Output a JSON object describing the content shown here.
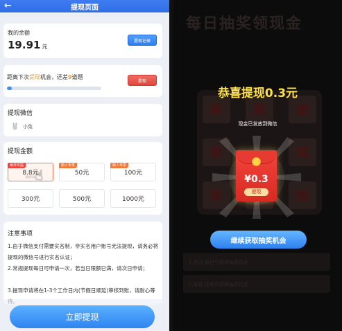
{
  "left": {
    "header": {
      "title": "提现页面",
      "back_icon": "back-arrow-icon"
    },
    "balance": {
      "label": "我的余额",
      "amount": "19.91",
      "unit": "元",
      "records_button": "提现记录"
    },
    "progress": {
      "prefix": "距离下次",
      "highlight": "提现",
      "middle": "机会，还差",
      "count": "9",
      "suffix": "道题",
      "withdraw_button": "提现",
      "percent": 5
    },
    "wechat": {
      "title": "提现微信",
      "user_name": "小兔",
      "avatar_icon": "bunny-avatar-icon"
    },
    "amounts": {
      "title": "提现金额",
      "options": [
        {
          "tag": "每日可提",
          "value": "8.8",
          "unit": "元",
          "sub": "提现1次",
          "selected": true
        },
        {
          "tag": "新人专享",
          "value": "50元"
        },
        {
          "tag": "新人专享",
          "value": "100元"
        },
        {
          "value": "300元"
        },
        {
          "value": "500元"
        },
        {
          "value": "1000元"
        }
      ]
    },
    "notes": {
      "title": "注意事项",
      "items": [
        "1.由于微信支付需要实名制，非实名用户账号无法提现，请务必将提现的微信号进行实名认证；",
        "2.常规提现每日可申请一次，若当日限额已满，请次日申请；",
        "3.提现申请将在1-3个工作日内(节假日顺延)审核到账，请耐心等待。"
      ]
    },
    "withdraw_now": "立即提现"
  },
  "right": {
    "background_title": "每日抽奖领现金",
    "congrats": "恭喜提现0.3元",
    "sent_text": "现金已发放到微信",
    "envelope_amount": "¥0.3",
    "envelope_label": "提现",
    "continue_button": "继续获取抽奖机会",
    "bg_rows": [
      "1.答对 题目可获得抽奖机会",
      "2.观看 视频可获得抽奖机会"
    ]
  }
}
